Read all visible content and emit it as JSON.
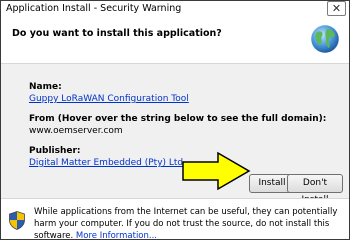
{
  "window": {
    "title": "Application Install - Security Warning",
    "close_glyph": "✕"
  },
  "header": {
    "question": "Do you want to install this application?",
    "icon": "globe-icon"
  },
  "fields": {
    "name_label": "Name:",
    "name_value": "Guppy LoRaWAN Configuration Tool",
    "from_label": "From (Hover over the string below to see the full domain):",
    "from_value": "www.oemserver.com",
    "publisher_label": "Publisher:",
    "publisher_value": "Digital Matter Embedded (Pty) Ltd"
  },
  "buttons": {
    "install": "Install",
    "dont_install": "Don't Install"
  },
  "footer": {
    "icon": "shield-icon",
    "warning": "While applications from the Internet can be useful, they can potentially harm your computer. If you do not trust the source, do not install this software.",
    "more_info": "More Information..."
  },
  "colors": {
    "link": "#0033cc",
    "arrow_fill": "#ffff00",
    "shield_yellow": "#f5c400",
    "shield_blue": "#2a5db0"
  }
}
